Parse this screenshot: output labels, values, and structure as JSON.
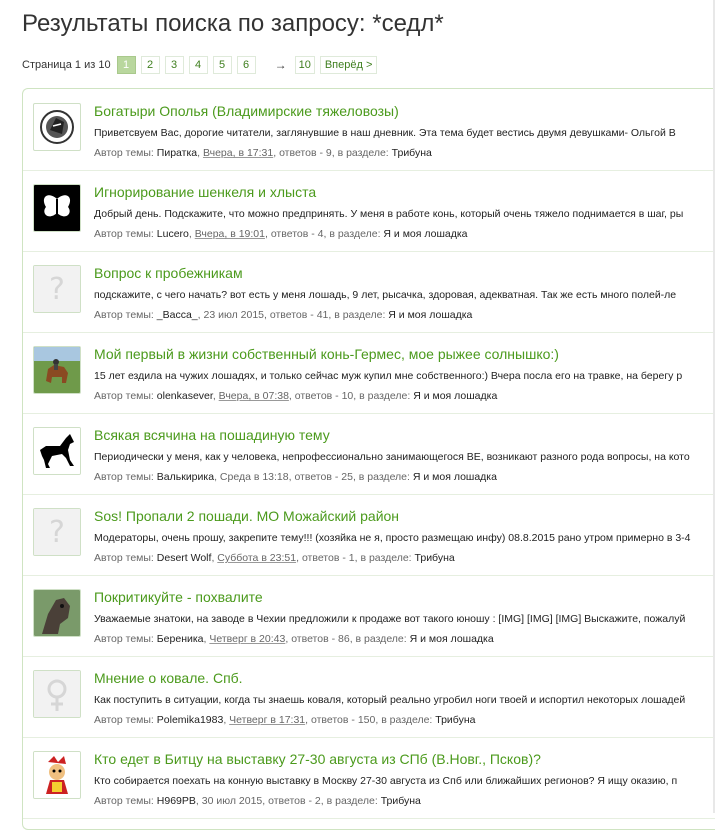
{
  "page": {
    "title": "Результаты поиска по запросу: *седл*",
    "pagination": {
      "label": "Страница 1 из 10",
      "pages": [
        "1",
        "2",
        "3",
        "4",
        "5",
        "6"
      ],
      "current": "1",
      "arrow": "→",
      "last": "10",
      "next": "Вперёд >"
    }
  },
  "labels": {
    "author_prefix": "Автор темы:",
    "replies_prefix": "ответов -",
    "section_prefix": "в разделе:"
  },
  "results": [
    {
      "avatar": "horse-logo-icon",
      "title": "Богатыри Ополья (Владимирские тяжеловозы)",
      "snippet": "Приветсвуем Вас, дорогие читатели, заглянувшие в наш дневник. Эта тема будет вестись двумя девушками- Ольгой В",
      "author": "Пиратка",
      "date": "Вчера, в 17:31",
      "date_underlined": true,
      "replies": "9",
      "section": "Трибуна"
    },
    {
      "avatar": "butterfly-icon",
      "title": "Игнорирование шенкеля и хлыста",
      "snippet": "Добрый день. Подскажите, что можно предпринять. У меня в работе конь, который очень тяжело поднимается в шаг, ры",
      "author": "Lucero",
      "date": "Вчера, в 19:01",
      "date_underlined": true,
      "replies": "4",
      "section": "Я и моя лошадка"
    },
    {
      "avatar": "question-mark-icon",
      "title": "Вопрос к пробежникам",
      "snippet": "подскажите, с чего начать? вот есть у меня лошадь, 9 лет, рысачка, здоровая, адекватная. Так же есть много полей-ле",
      "author": "_Васса_",
      "date": "23 июл 2015",
      "date_underlined": false,
      "replies": "41",
      "section": "Я и моя лошадка"
    },
    {
      "avatar": "horse-photo-icon",
      "title": "Мой первый в жизни собственный конь-Гермес, мое рыжее солнышко:)",
      "snippet": "15 лет ездила на чужих лошадях, и только сейчас муж купил мне собственного:) Вчера посла его на травке, на берегу р",
      "author": "olenkasever",
      "date": "Вчера, в 07:38",
      "date_underlined": true,
      "replies": "10",
      "section": "Я и моя лошадка"
    },
    {
      "avatar": "horse-silhouette-icon",
      "title": "Всякая всячина на пошадиную тему",
      "snippet": "Периодически у меня, как у человека, непрофессионально занимающегося ВЕ, возникают разного рода вопросы, на кото",
      "author": "Валькирика",
      "date": "Среда в 13:18",
      "date_underlined": false,
      "replies": "25",
      "section": "Я и моя лошадка"
    },
    {
      "avatar": "question-mark-icon",
      "title": "Sos! Пропали 2 пошади. МО Можайский район",
      "snippet": "Модераторы, очень прошу, закрепите тему!!! (хозяйка не я, просто размещаю инфу) 08.8.2015 рано утром примерно в 3-4",
      "author": "Desert Wolf",
      "date": "Суббота в 23:51",
      "date_underlined": true,
      "replies": "1",
      "section": "Трибуна"
    },
    {
      "avatar": "horse-head-photo-icon",
      "title": "Покритикуйте - похвалите",
      "snippet": "Уважаемые знатоки, на заводе в Чехии предложили к продаже вот такого юношу : [IMG] [IMG] [IMG] Выскажите, пожалуй",
      "author": "Береника",
      "date": "Четверг в 20:43",
      "date_underlined": true,
      "replies": "86",
      "section": "Я и моя лошадка"
    },
    {
      "avatar": "female-symbol-icon",
      "title": "Мнение о ковале. Спб.",
      "snippet": "Как поступить в ситуации, когда ты знаешь коваля, который реально угробил ноги твоей и испортил некоторых лошадей",
      "author": "Polemika1983",
      "date": "Четверг в 17:31",
      "date_underlined": true,
      "replies": "150",
      "section": "Трибуна"
    },
    {
      "avatar": "cartoon-character-icon",
      "title": "Кто едет в Битцу на выставку 27-30 августа из СПб (В.Новг., Псков)?",
      "snippet": "Кто собирается поехать на конную выставку в Москву 27-30 августа из Спб или ближайших регионов? Я ищу оказию, п",
      "author": "H969PB",
      "date": "30 июл 2015",
      "date_underlined": false,
      "replies": "2",
      "section": "Трибуна"
    }
  ],
  "colors": {
    "accent_green": "#4b9a1c",
    "current_page_bg": "#b9d79e",
    "border_green": "#cfe4c2"
  }
}
